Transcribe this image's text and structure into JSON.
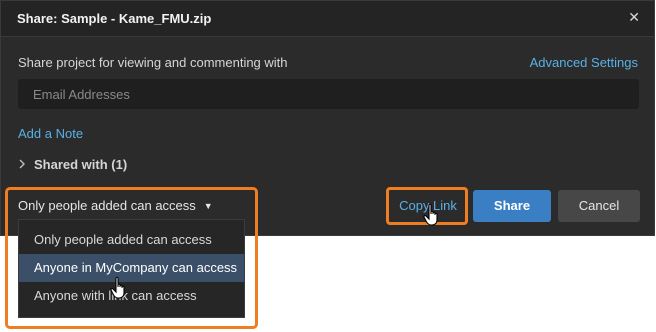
{
  "dialog": {
    "title": "Share: Sample - Kame_FMU.zip",
    "close_icon": "close-icon",
    "share_label": "Share project for viewing and commenting with",
    "advanced_settings": "Advanced Settings",
    "email_placeholder": "Email Addresses",
    "add_note": "Add a Note",
    "shared_with": "Shared with (1)",
    "access_selected": "Only people added can access",
    "buttons": {
      "copy_link": "Copy Link",
      "share": "Share",
      "cancel": "Cancel"
    }
  },
  "access_dropdown": {
    "options": [
      "Only people added can access",
      "Anyone in MyCompany can access",
      "Anyone with link can access"
    ],
    "highlighted_index": 1
  },
  "colors": {
    "accent_link": "#5ab0e6",
    "primary_button": "#3a7fc4",
    "highlight_outline": "#ef7d22",
    "dialog_bg": "#2b2b2b"
  },
  "icons": {
    "close": "close-icon",
    "chevron": "chevron-right-icon",
    "caret": "caret-down-icon",
    "pointer": "hand-pointer-icon"
  }
}
